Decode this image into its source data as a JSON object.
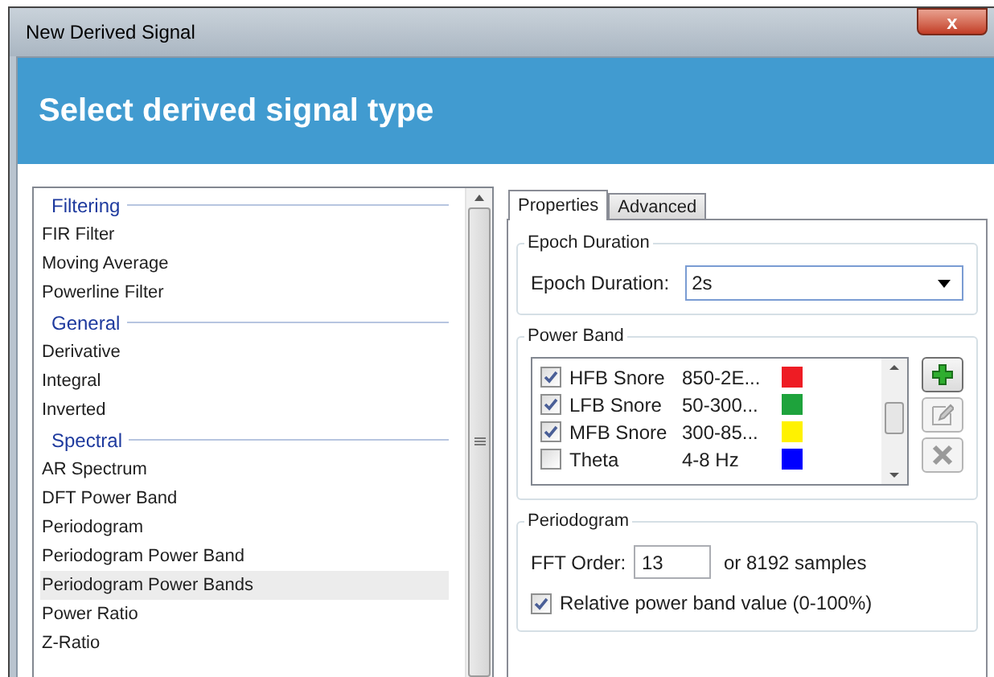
{
  "window": {
    "title": "New Derived Signal",
    "close": "x"
  },
  "header": "Select derived signal type",
  "signal_list": [
    {
      "kind": "header",
      "label": "Filtering"
    },
    {
      "kind": "item",
      "label": "FIR Filter",
      "selected": false
    },
    {
      "kind": "item",
      "label": "Moving Average",
      "selected": false
    },
    {
      "kind": "item",
      "label": "Powerline Filter",
      "selected": false
    },
    {
      "kind": "header",
      "label": "General"
    },
    {
      "kind": "item",
      "label": "Derivative",
      "selected": false
    },
    {
      "kind": "item",
      "label": "Integral",
      "selected": false
    },
    {
      "kind": "item",
      "label": "Inverted",
      "selected": false
    },
    {
      "kind": "header",
      "label": "Spectral"
    },
    {
      "kind": "item",
      "label": "AR Spectrum",
      "selected": false
    },
    {
      "kind": "item",
      "label": "DFT Power Band",
      "selected": false
    },
    {
      "kind": "item",
      "label": "Periodogram",
      "selected": false
    },
    {
      "kind": "item",
      "label": "Periodogram Power Band",
      "selected": false
    },
    {
      "kind": "item",
      "label": "Periodogram Power Bands",
      "selected": true
    },
    {
      "kind": "item",
      "label": "Power Ratio",
      "selected": false
    },
    {
      "kind": "item",
      "label": "Z-Ratio",
      "selected": false
    }
  ],
  "tabs": [
    {
      "label": "Properties",
      "selected": true
    },
    {
      "label": "Advanced",
      "selected": false
    }
  ],
  "epoch_group": {
    "title": "Epoch Duration",
    "label": "Epoch Duration:",
    "value": "2s"
  },
  "power_band_group": {
    "title": "Power Band",
    "bands": [
      {
        "name": "HFB Snore",
        "range": "850-2E...",
        "color": "#ee1c24",
        "checked": true
      },
      {
        "name": "LFB Snore",
        "range": "50-300...",
        "color": "#1ea33c",
        "checked": true
      },
      {
        "name": "MFB Snore",
        "range": "300-85...",
        "color": "#fff200",
        "checked": true
      },
      {
        "name": "Theta",
        "range": "4-8 Hz",
        "color": "#0000ff",
        "checked": false
      }
    ]
  },
  "periodogram_group": {
    "title": "Periodogram",
    "fft_label": "FFT Order:",
    "fft_value": "13",
    "samples": "or 8192 samples",
    "relative": {
      "label": "Relative power band value (0-100%)",
      "checked": true
    }
  }
}
